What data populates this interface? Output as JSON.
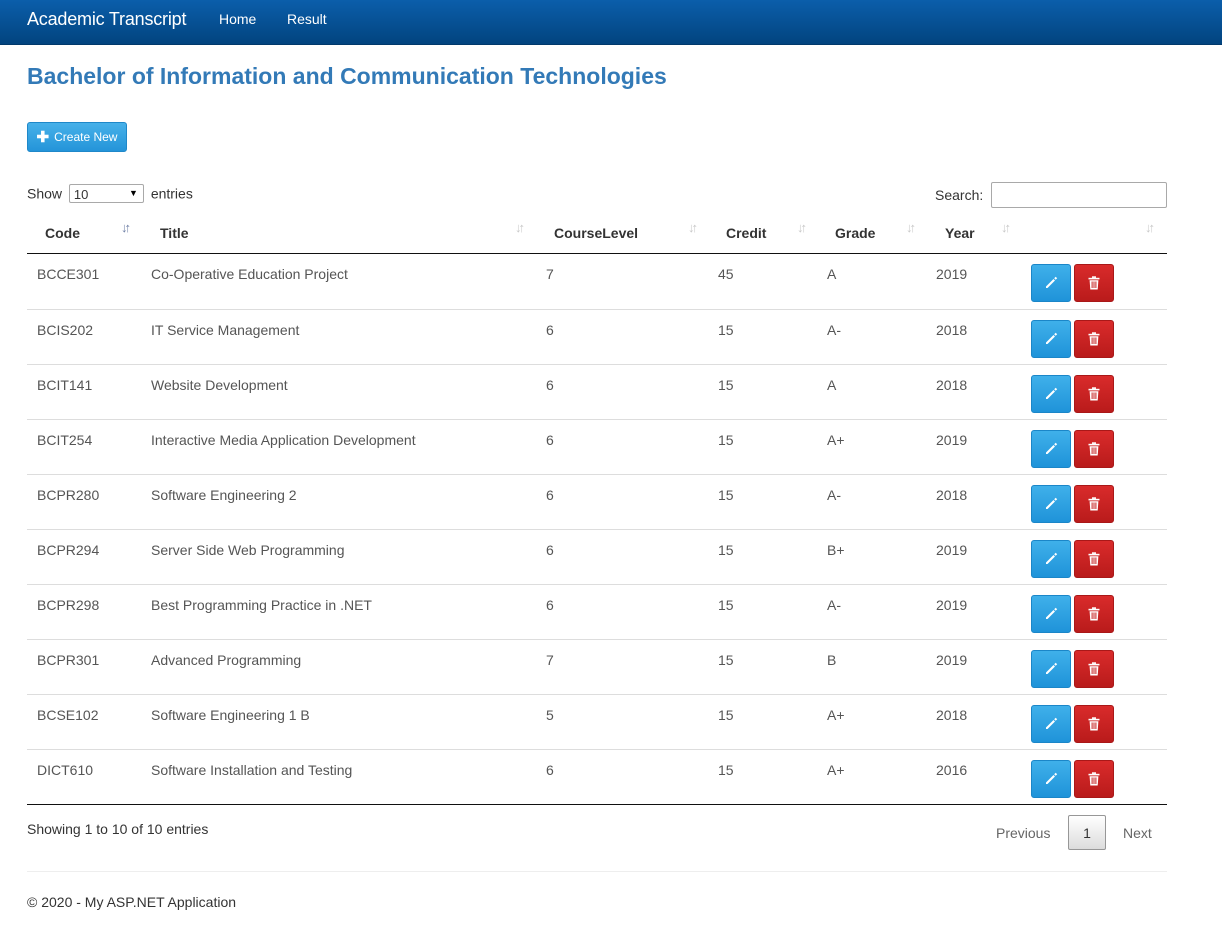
{
  "navbar": {
    "brand": "Academic Transcript",
    "links": [
      "Home",
      "Result"
    ]
  },
  "page": {
    "title": "Bachelor of Information and Communication Technologies",
    "create_label": "Create New"
  },
  "table_controls": {
    "show_label": "Show",
    "entries_label": "entries",
    "page_length": "10",
    "search_label": "Search:",
    "search_value": ""
  },
  "columns": [
    "Code",
    "Title",
    "CourseLevel",
    "Credit",
    "Grade",
    "Year",
    ""
  ],
  "sort": {
    "column": "Code",
    "direction": "ascending"
  },
  "rows": [
    {
      "code": "BCCE301",
      "title": "Co-Operative Education Project",
      "level": "7",
      "credit": "45",
      "grade": "A",
      "year": "2019"
    },
    {
      "code": "BCIS202",
      "title": "IT Service Management",
      "level": "6",
      "credit": "15",
      "grade": "A-",
      "year": "2018"
    },
    {
      "code": "BCIT141",
      "title": "Website Development",
      "level": "6",
      "credit": "15",
      "grade": "A",
      "year": "2018"
    },
    {
      "code": "BCIT254",
      "title": "Interactive Media Application Development",
      "level": "6",
      "credit": "15",
      "grade": "A+",
      "year": "2019"
    },
    {
      "code": "BCPR280",
      "title": "Software Engineering 2",
      "level": "6",
      "credit": "15",
      "grade": "A-",
      "year": "2018"
    },
    {
      "code": "BCPR294",
      "title": "Server Side Web Programming",
      "level": "6",
      "credit": "15",
      "grade": "B+",
      "year": "2019"
    },
    {
      "code": "BCPR298",
      "title": "Best Programming Practice in .NET",
      "level": "6",
      "credit": "15",
      "grade": "A-",
      "year": "2019"
    },
    {
      "code": "BCPR301",
      "title": "Advanced Programming",
      "level": "7",
      "credit": "15",
      "grade": "B",
      "year": "2019"
    },
    {
      "code": "BCSE102",
      "title": "Software Engineering 1 B",
      "level": "5",
      "credit": "15",
      "grade": "A+",
      "year": "2018"
    },
    {
      "code": "DICT610",
      "title": "Software Installation and Testing",
      "level": "6",
      "credit": "15",
      "grade": "A+",
      "year": "2016"
    }
  ],
  "row_actions": {
    "edit_icon": "pencil-icon",
    "delete_icon": "trash-icon"
  },
  "pagination": {
    "info": "Showing 1 to 10 of 10 entries",
    "previous": "Previous",
    "current": "1",
    "next": "Next"
  },
  "footer": {
    "text": "© 2020 - My ASP.NET Application"
  },
  "colors": {
    "navbar": "#034c92",
    "title": "#337ab7",
    "primary_button": "#2494d9",
    "danger_button": "#c62222"
  }
}
